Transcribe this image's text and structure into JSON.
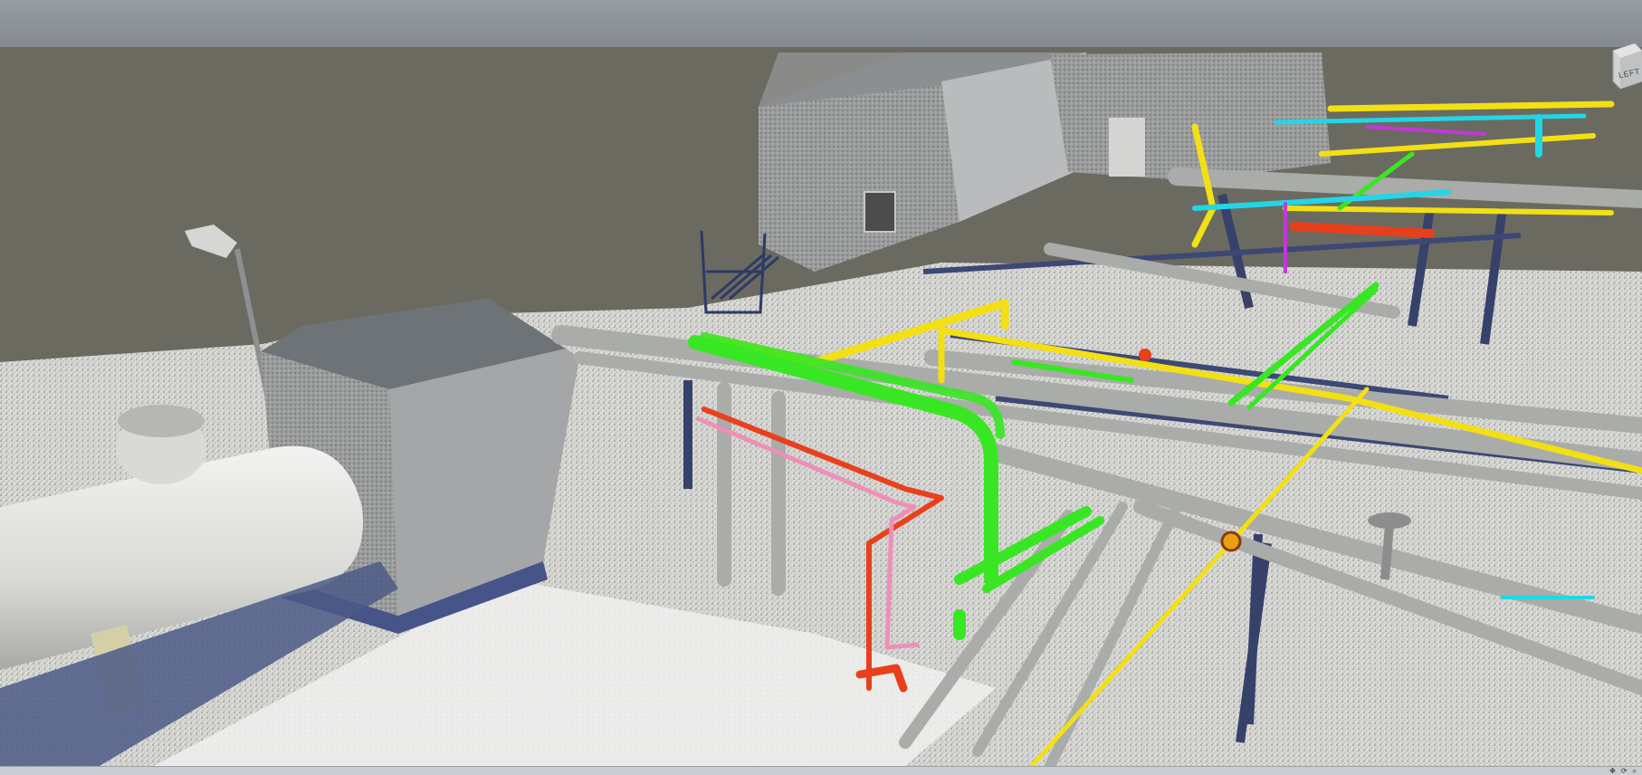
{
  "viewer": {
    "viewcube_face": "LEFT"
  },
  "colors": {
    "sky": "#8c9198",
    "backdrop": "#6b6a60",
    "ground": "#e6e6e3",
    "steel": "#37426b",
    "pipe_grey": "#a9aca8",
    "pipe_green": "#39e624",
    "pipe_yellow": "#f2e014",
    "pipe_red": "#e8401c",
    "pipe_pink": "#ee8fb8",
    "pipe_cyan": "#22d6e6",
    "pipe_magenta": "#c238d8"
  },
  "icons": {
    "viewcube": "viewcube-icon",
    "status_tools": [
      "pan-icon",
      "orbit-icon",
      "zoom-icon"
    ]
  }
}
